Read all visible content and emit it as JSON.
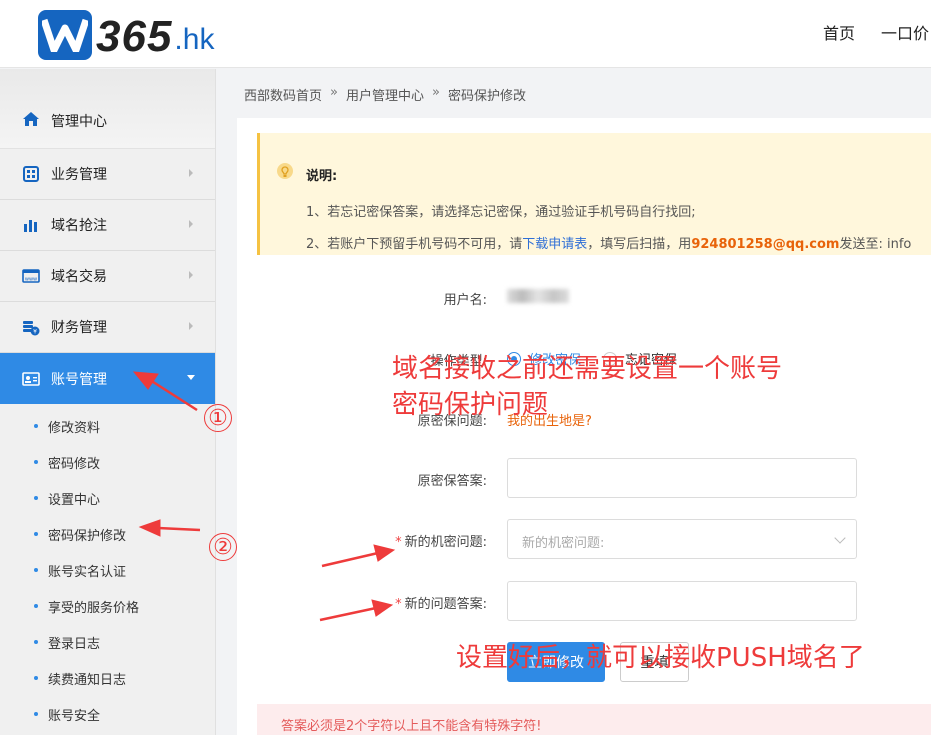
{
  "header": {
    "logo_main": "365",
    "logo_suffix": ".hk",
    "nav": [
      "首页",
      "一口价"
    ]
  },
  "sidebar": {
    "home": "管理中心",
    "items": [
      {
        "label": "业务管理",
        "icon": "grid-icon"
      },
      {
        "label": "域名抢注",
        "icon": "bar-chart-icon"
      },
      {
        "label": "域名交易",
        "icon": "www-icon"
      },
      {
        "label": "财务管理",
        "icon": "coins-icon"
      },
      {
        "label": "账号管理",
        "icon": "id-card-icon",
        "active": true
      }
    ],
    "sub_items": [
      "修改资料",
      "密码修改",
      "设置中心",
      "密码保护修改",
      "账号实名认证",
      "享受的服务价格",
      "登录日志",
      "续费通知日志",
      "账号安全"
    ]
  },
  "breadcrumb": [
    "西部数码首页",
    "用户管理中心",
    "密码保护修改"
  ],
  "breadcrumb_sep": "»",
  "notice": {
    "title": "说明:",
    "line1": "1、若忘记密保答案，请选择忘记密保，通过验证手机号码自行找回;",
    "line2_a": "2、若账户下预留手机号码不可用，请",
    "line2_link": "下载申请表",
    "line2_b": "，填写后扫描，用",
    "line2_email": "924801258@qq.com",
    "line2_c": "发送至: info"
  },
  "form": {
    "username_label": "用户名:",
    "op_type_label": "操作类型:",
    "op_modify": "修改密保",
    "op_forgot": "忘记密保",
    "orig_q_label": "原密保问题:",
    "orig_q_value": "我的出生地是?",
    "orig_a_label": "原密保答案:",
    "new_q_label": "新的机密问题:",
    "new_q_placeholder": "新的机密问题:",
    "new_a_label": "新的问题答案:",
    "submit": "立即修改",
    "reset": "重填",
    "error": "答案必须是2个字符以上且不能含有特殊字符!"
  },
  "annotations": {
    "text1_line1": "域名接收之前还需要设置一个账号",
    "text1_line2": "密码保护问题",
    "text2": "设置好后，就可以接收PUSH域名了",
    "num1": "①",
    "num2": "②"
  },
  "colors": {
    "accent": "#2f8ae5",
    "annotation": "#ee3b3b",
    "warn": "#e8630a"
  }
}
